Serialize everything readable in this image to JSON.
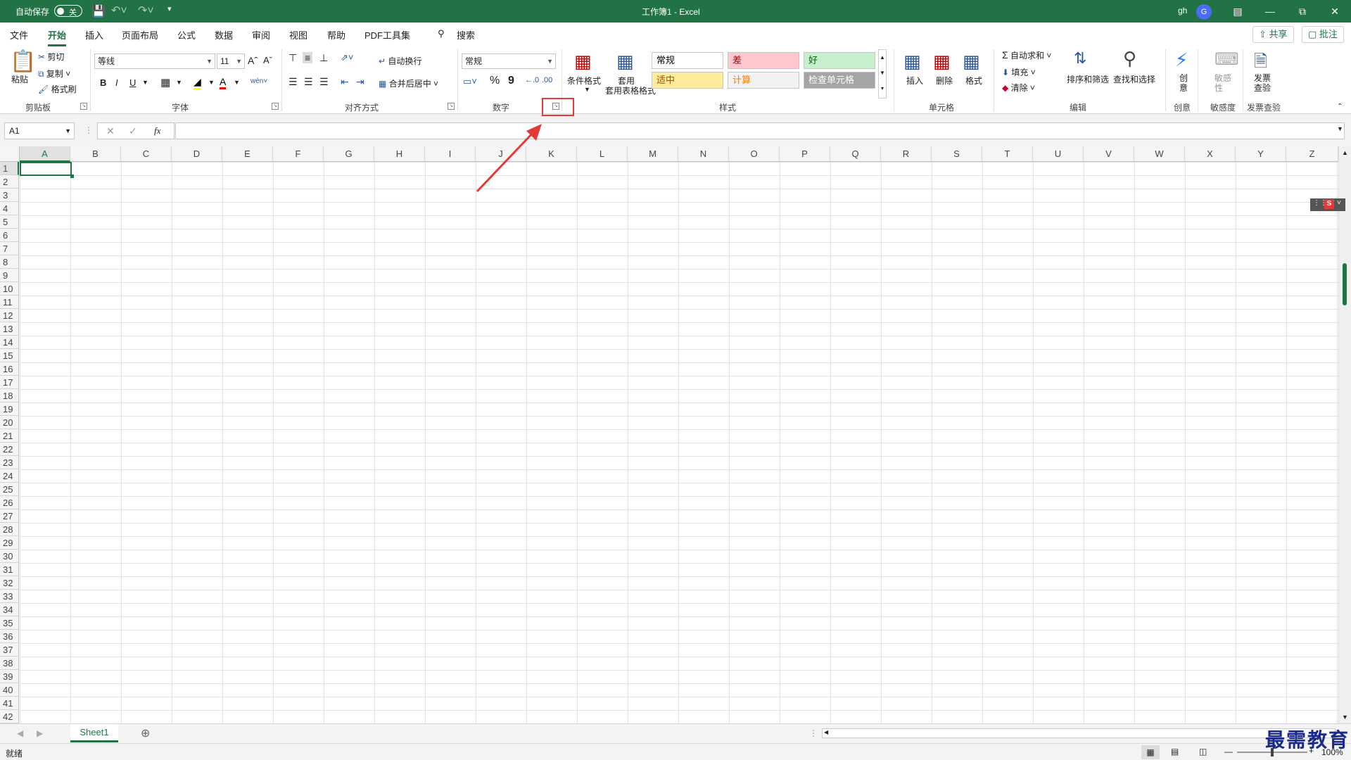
{
  "titlebar": {
    "autosave_label": "自动保存",
    "autosave_state": "关",
    "title": "工作簿1  -  Excel",
    "user_name": "gh",
    "avatar_letter": "G"
  },
  "menu": {
    "tabs": [
      "文件",
      "开始",
      "插入",
      "页面布局",
      "公式",
      "数据",
      "审阅",
      "视图",
      "帮助",
      "PDF工具集"
    ],
    "active": "开始",
    "search_label": "搜索",
    "share_label": "共享",
    "comment_label": "批注"
  },
  "ribbon": {
    "clipboard": {
      "paste": "粘贴",
      "cut": "剪切",
      "copy": "复制",
      "format_painter": "格式刷",
      "label": "剪贴板"
    },
    "font": {
      "font_name": "等线",
      "font_size": "11",
      "bold": "B",
      "italic": "I",
      "underline": "U",
      "label": "字体"
    },
    "alignment": {
      "wrap_text": "自动换行",
      "merge_center": "合并后居中",
      "label": "对齐方式"
    },
    "number": {
      "format": "常规",
      "percent": "%",
      "comma": "9",
      "label": "数字"
    },
    "styles": {
      "conditional": "条件格式",
      "table_format": "套用表格格式",
      "boxes": [
        {
          "text": "常规",
          "bg": "#ffffff",
          "fg": "#000000"
        },
        {
          "text": "差",
          "bg": "#ffc7ce",
          "fg": "#9c0006"
        },
        {
          "text": "好",
          "bg": "#c6efce",
          "fg": "#006100"
        },
        {
          "text": "适中",
          "bg": "#ffeb9c",
          "fg": "#9c5700"
        },
        {
          "text": "计算",
          "bg": "#f2f2f2",
          "fg": "#fa7d00"
        },
        {
          "text": "检查单元格",
          "bg": "#a5a5a5",
          "fg": "#ffffff"
        }
      ],
      "label": "样式"
    },
    "cells": {
      "insert": "插入",
      "delete": "删除",
      "format": "格式",
      "label": "单元格"
    },
    "editing": {
      "autosum": "自动求和",
      "fill": "填充",
      "clear": "清除",
      "sort_filter": "排序和筛选",
      "find_select": "查找和选择",
      "label": "编辑"
    },
    "ideas": {
      "button": "创意",
      "label": "创意"
    },
    "sensitivity": {
      "button": "敏感性",
      "label": "敏感度"
    },
    "invoice": {
      "button": "发票查验",
      "label": "发票查验"
    }
  },
  "formula_bar": {
    "name_box": "A1",
    "fx": "fx",
    "value": ""
  },
  "grid": {
    "columns": [
      "A",
      "B",
      "C",
      "D",
      "E",
      "F",
      "G",
      "H",
      "I",
      "J",
      "K",
      "L",
      "M",
      "N",
      "O",
      "P",
      "Q",
      "R",
      "S",
      "T",
      "U",
      "V",
      "W",
      "X",
      "Y",
      "Z"
    ],
    "row_count": 42,
    "selected_cell": "A1"
  },
  "sheets": {
    "tabs": [
      "Sheet1"
    ],
    "active": "Sheet1"
  },
  "status": {
    "ready": "就绪",
    "zoom": "100%"
  },
  "watermark": "最需教育",
  "accent": "#217346"
}
